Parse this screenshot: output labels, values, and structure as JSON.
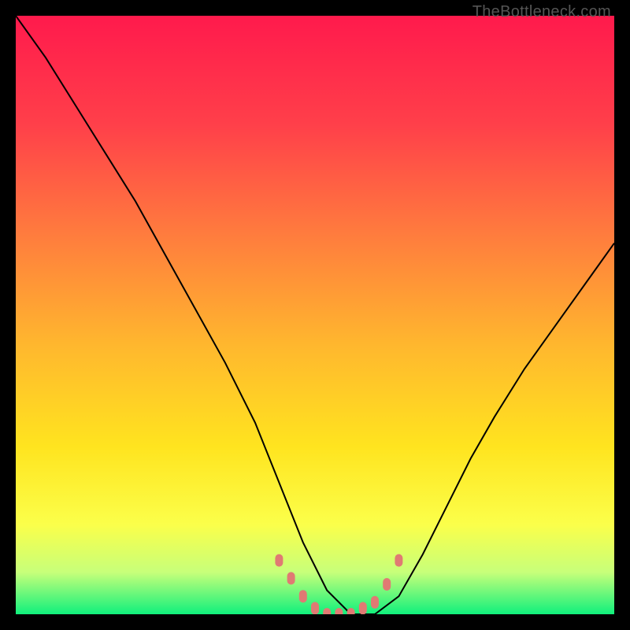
{
  "watermark": "TheBottleneck.com",
  "chart_data": {
    "type": "line",
    "title": "",
    "xlabel": "",
    "ylabel": "",
    "xlim": [
      0,
      100
    ],
    "ylim": [
      0,
      100
    ],
    "grid": false,
    "legend": false,
    "series": [
      {
        "name": "bottleneck-curve",
        "x": [
          0,
          5,
          10,
          15,
          20,
          25,
          30,
          35,
          40,
          44,
          48,
          52,
          56,
          60,
          64,
          68,
          72,
          76,
          80,
          85,
          90,
          95,
          100
        ],
        "y": [
          100,
          93,
          85,
          77,
          69,
          60,
          51,
          42,
          32,
          22,
          12,
          4,
          0,
          0,
          3,
          10,
          18,
          26,
          33,
          41,
          48,
          55,
          62
        ]
      },
      {
        "name": "optimal-markers",
        "x": [
          44,
          46,
          48,
          50,
          52,
          54,
          56,
          58,
          60,
          62,
          64
        ],
        "y": [
          9,
          6,
          3,
          1,
          0,
          0,
          0,
          1,
          2,
          5,
          9
        ]
      }
    ],
    "background_gradient": {
      "stops": [
        {
          "offset": 0.0,
          "color": "#ff1a4c"
        },
        {
          "offset": 0.18,
          "color": "#ff3f4a"
        },
        {
          "offset": 0.36,
          "color": "#ff7a3e"
        },
        {
          "offset": 0.55,
          "color": "#ffb72e"
        },
        {
          "offset": 0.72,
          "color": "#ffe41f"
        },
        {
          "offset": 0.85,
          "color": "#fbff4a"
        },
        {
          "offset": 0.93,
          "color": "#c7ff7a"
        },
        {
          "offset": 1.0,
          "color": "#10f07c"
        }
      ]
    },
    "marker_color": "#e07a73",
    "line_color": "#000000"
  }
}
